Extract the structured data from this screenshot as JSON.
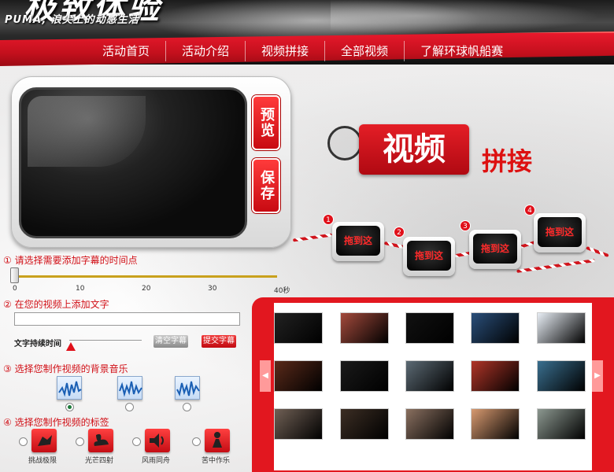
{
  "header": {
    "logo_slogan": "PUMA, 浪尖上的动感生活",
    "title": "极致体验"
  },
  "nav": {
    "items": [
      "活动首页",
      "活动介绍",
      "视频拼接",
      "全部视频",
      "了解环球帆船赛"
    ]
  },
  "player": {
    "preview_label": "预览",
    "save_label": "保存"
  },
  "heading": {
    "main": "视频",
    "sub": "拼接"
  },
  "slots": [
    {
      "num": "1",
      "label": "拖到这"
    },
    {
      "num": "2",
      "label": "拖到这"
    },
    {
      "num": "3",
      "label": "拖到这"
    },
    {
      "num": "4",
      "label": "拖到这"
    }
  ],
  "step1": {
    "label": "① 请选择需要添加字幕的时间点",
    "ticks": [
      "0",
      "10",
      "20",
      "30",
      "40秒"
    ],
    "position_seconds": 0
  },
  "step2": {
    "label": "② 在您的视频上添加文字",
    "input_value": "",
    "duration_label": "文字持续时间",
    "clear_label": "清空字幕",
    "submit_label": "提交字幕"
  },
  "step3": {
    "label": "③ 选择您制作视频的背景音乐",
    "music_icon": "waveform-icon",
    "selected_index": 0
  },
  "step4": {
    "label": "④ 选择您制作视频的标签",
    "tags": [
      "挑战极限",
      "光芒四射",
      "风雨同舟",
      "苦中作乐"
    ],
    "tag_icons": [
      "diver-icon",
      "swan-icon",
      "speaker-icon",
      "figure-icon"
    ]
  },
  "gallery": {
    "arrow_left": "◀",
    "arrow_right": "▶",
    "thumb_colors": [
      "#222222",
      "#a34a3c",
      "#111111",
      "#2a4f7a",
      "#e8eef5",
      "#5a2a1a",
      "#1a1a1a",
      "#5c6a74",
      "#b03528",
      "#3a6f8f",
      "#706055",
      "#3c2e24",
      "#8a7060",
      "#d89a70",
      "#8c9890"
    ]
  },
  "colors": {
    "brand_red": "#e2171f",
    "accent_gold": "#c9a11d"
  }
}
